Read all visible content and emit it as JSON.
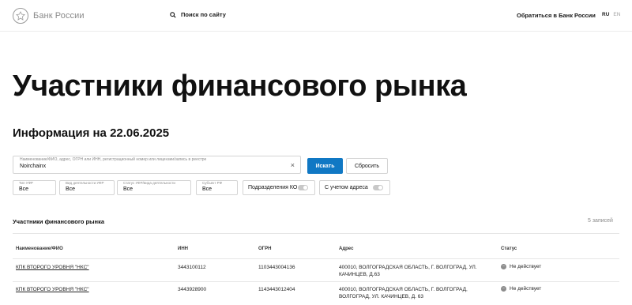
{
  "header": {
    "logo_text": "Банк России",
    "search_label": "Поиск по сайту",
    "contact_label": "Обратиться в Банк России",
    "lang_ru": "RU",
    "lang_en": "EN"
  },
  "page": {
    "title": "Участники финансового рынка",
    "info_date": "Информация на 22.06.2025"
  },
  "search": {
    "field_label": "Наименование/ФИО, адрес, ОГРН или ИНН, регистрационный номер или лицензии/запись в реестре",
    "value": "Noirchainx",
    "search_button": "Искать",
    "reset_button": "Сбросить"
  },
  "filters": {
    "type_label": "Тип УФР",
    "type_value": "Все",
    "activity_label": "Вид деятельности УФР",
    "activity_value": "Все",
    "status_label": "Статус УФР/вида деятельности",
    "status_value": "Все",
    "region_label": "Субъект РФ",
    "region_value": "Все",
    "branches_toggle": "Подразделения КО",
    "address_toggle": "С учетом адреса"
  },
  "results": {
    "title": "Участники финансового рынка",
    "count": "5 записей",
    "columns": [
      "Наименование/ФИО",
      "ИНН",
      "ОГРН",
      "Адрес",
      "Статус"
    ],
    "rows": [
      {
        "name": "КПК ВТОРОГО УРОВНЯ \"НКС\"",
        "inn": "3443100112",
        "ogrn": "1103443004136",
        "address_line1": "400010, ВОЛГОГРАДСКАЯ ОБЛАСТЬ, Г. ВОЛГОГРАД, УЛ.",
        "address_line2": "КАЧИНЦЕВ, Д.63",
        "status": "Не действует"
      },
      {
        "name": "КПК ВТОРОГО УРОВНЯ \"НКС\"",
        "inn": "3443928900",
        "ogrn": "1143443012404",
        "address_line1": "400010, ВОЛГОГРАДСКАЯ ОБЛАСТЬ, Г. ВОЛГОГРАД,",
        "address_line2": "ВОЛГОГРАД, УЛ. КАЧИНЦЕВ, Д. 63",
        "status": "Не действует"
      }
    ]
  },
  "colors": {
    "accent": "#1078c4",
    "status_inactive": "#8c8c8c"
  },
  "icons": {
    "logo": "bank-emblem-icon",
    "search": "search-icon",
    "clear": "close-icon",
    "status": "minus-circle-icon"
  }
}
